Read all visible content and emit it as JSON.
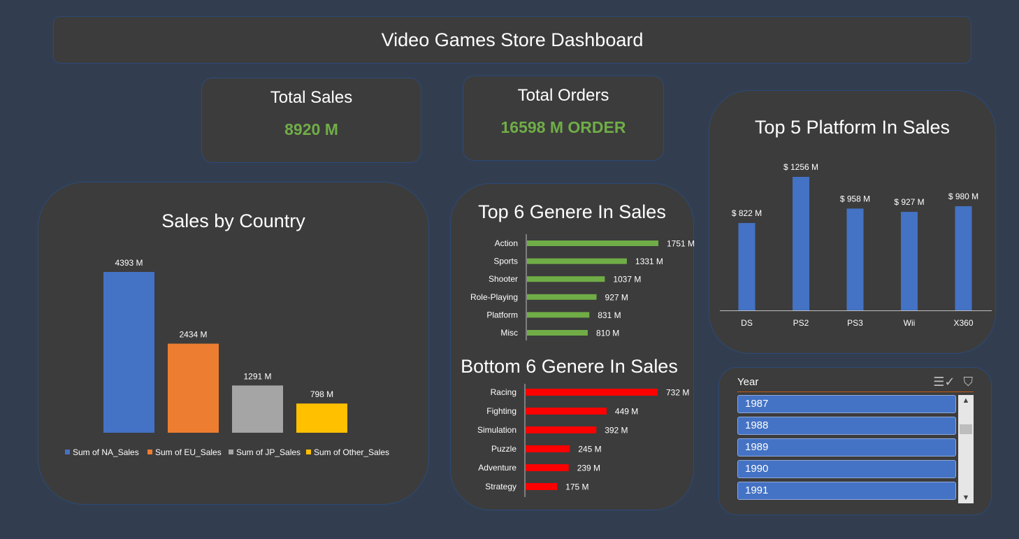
{
  "dashboard": {
    "title": "Video Games Store Dashboard"
  },
  "kpis": {
    "total_sales": {
      "label": "Total Sales",
      "value": "8920 M"
    },
    "total_orders": {
      "label": "Total Orders",
      "value": "16598 M ORDER"
    }
  },
  "colors": {
    "background": "#323e50",
    "panel": "#3c3c3c",
    "border": "#2c4a78",
    "blue": "#4472c4",
    "orange": "#ed7d31",
    "gray": "#a5a5a5",
    "yellow": "#ffc000",
    "green": "#70ad47",
    "red": "#ff0000"
  },
  "chart_data": [
    {
      "id": "sales_by_country",
      "type": "bar",
      "title": "Sales by Country",
      "categories": [
        "Sum of NA_Sales",
        "Sum of EU_Sales",
        "Sum of JP_Sales",
        "Sum of Other_Sales"
      ],
      "values": [
        4393,
        2434,
        1291,
        798
      ],
      "data_labels": [
        "4393 M",
        "2434 M",
        "1291 M",
        "798 M"
      ],
      "colors": [
        "#4472c4",
        "#ed7d31",
        "#a5a5a5",
        "#ffc000"
      ],
      "legend": "bottom",
      "ylim": [
        0,
        4393
      ],
      "grid": false
    },
    {
      "id": "top_genres",
      "type": "bar",
      "orientation": "horizontal",
      "title": "Top 6 Genere In Sales",
      "categories": [
        "Action",
        "Sports",
        "Shooter",
        "Role-Playing",
        "Platform",
        "Misc"
      ],
      "values": [
        1751,
        1331,
        1037,
        927,
        831,
        810
      ],
      "data_labels": [
        "1751 M",
        "1331 M",
        "1037 M",
        "927 M",
        "831 M",
        "810 M"
      ],
      "color": "#70ad47",
      "xlim": [
        0,
        1751
      ],
      "grid": false
    },
    {
      "id": "bottom_genres",
      "type": "bar",
      "orientation": "horizontal",
      "title": "Bottom 6 Genere In Sales",
      "categories": [
        "Racing",
        "Fighting",
        "Simulation",
        "Puzzle",
        "Adventure",
        "Strategy"
      ],
      "values": [
        732,
        449,
        392,
        245,
        239,
        175
      ],
      "data_labels": [
        "732 M",
        "449 M",
        "392 M",
        "245 M",
        "239 M",
        "175 M"
      ],
      "color": "#ff0000",
      "xlim": [
        0,
        732
      ],
      "grid": false
    },
    {
      "id": "top_platforms",
      "type": "bar",
      "title": "Top 5 Platform In Sales",
      "categories": [
        "DS",
        "PS2",
        "PS3",
        "Wii",
        "X360"
      ],
      "values": [
        822,
        1256,
        958,
        927,
        980
      ],
      "data_labels": [
        "$ 822 M",
        "$ 1256 M",
        "$ 958 M",
        "$ 927 M",
        "$ 980 M"
      ],
      "color": "#4472c4",
      "ylim": [
        0,
        1256
      ],
      "grid": false
    }
  ],
  "slicer": {
    "header": "Year",
    "icons": [
      "multi-select-icon",
      "clear-filter-icon"
    ],
    "items": [
      "1987",
      "1988",
      "1989",
      "1990",
      "1991"
    ]
  }
}
